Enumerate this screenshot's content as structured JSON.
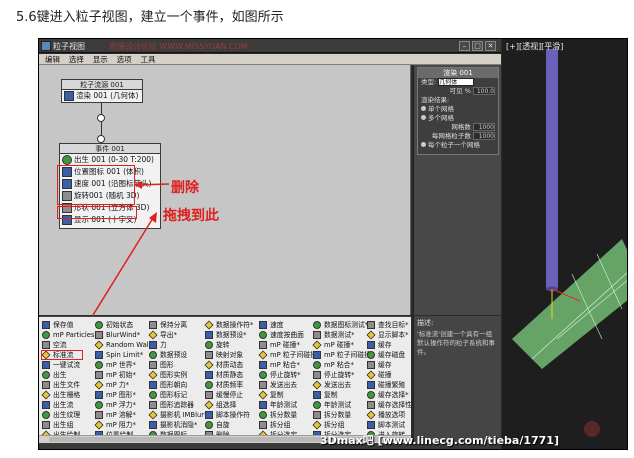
{
  "caption": "5.6键进入粒子视图，建立一个事件，如图所示",
  "window": {
    "title": "粒子视图",
    "watermark": "思缘设计论坛 WWW.MISSYUAN.COM"
  },
  "menu": [
    "编辑",
    "选择",
    "显示",
    "选项",
    "工具"
  ],
  "node_top": {
    "header": "粒子流源 001",
    "rows": [
      "渲染 001 (几何体)"
    ]
  },
  "node_event": {
    "header": "事件 001",
    "rows": [
      "出生 001 (0-30 T:200)",
      "位置图标 001 (体积)",
      "速度 001 (沿图标箭头)",
      "旋转001 (随机 3D)",
      "形状 001 (立方体 3D)",
      "显示 001 (十字叉)"
    ]
  },
  "annotations": {
    "delete": "删除",
    "drag": "拖拽到此"
  },
  "props": {
    "header": "渲染 001",
    "type_label": "类型:",
    "type_value": "几何体",
    "visible_label": "可见 %",
    "visible_value": "100.0",
    "render_label": "渲染结果:",
    "opt1": "单个网格",
    "opt2": "多个网格",
    "mesh_label": "网格数",
    "mesh_value": "1000",
    "per_label": "每网格粒子数",
    "per_value": "1000",
    "opt3": "每个粒子一个网格"
  },
  "depot": [
    [
      "保存值",
      "mP Particles 流",
      "空流",
      "标准流",
      "一键试流",
      "出生",
      "出生文件",
      "出生栅格",
      "出生流",
      "出生纹理",
      "出生组",
      "出生绘制",
      "出生脚本"
    ],
    [
      "初始状态",
      "BlurWind*",
      "Random Walk*",
      "Spin Limit*",
      "mP 世界*",
      "mP 初始*",
      "mP 力*",
      "mP 图形*",
      "mP 浮力*",
      "mP 溶解*",
      "mP 阻力*",
      "位置绘制",
      "位置对象"
    ],
    [
      "保持分离",
      "导出*",
      "力",
      "数据预设",
      "图形",
      "图形实例",
      "图形朝向",
      "图形标记",
      "图形追踪器",
      "摄影机 IMBlur*",
      "摄影机消隐*",
      "数据图标",
      "数据操作符*"
    ],
    [
      "数据操作符*",
      "数据预设*",
      "旋转",
      "映射对象",
      "材质动态",
      "材质静态",
      "材质频率",
      "缓慢停止",
      "组选择",
      "脚本操作符",
      "自旋",
      "删除",
      "数据图标*"
    ],
    [
      "速度",
      "速度按曲面",
      "mP 碰撞*",
      "mP 粒子间碰撞*",
      "mP 粘合*",
      "停止旋转*",
      "发送出去",
      "复制",
      "年龄测试",
      "拆分数量",
      "拆分组",
      "拆分选定",
      "拆分源"
    ],
    [
      "数据图标测试*",
      "数据测试*",
      "mP 碰撞*",
      "mP 粒子间碰撞*",
      "mP 粘合*",
      "停止旋转*",
      "发送出去",
      "复制",
      "年龄测试",
      "拆分数量",
      "拆分组",
      "拆分选定",
      "锁定/粘着"
    ],
    [
      "查找目标*",
      "显示脚本*",
      "缓存",
      "缓存磁盘",
      "缓存",
      "碰撞",
      "碰撞繁殖",
      "缓存选择*",
      "缓存选择性*",
      "播放选项",
      "脚本测试",
      "进入旋转",
      "速度测试"
    ]
  ],
  "desc": {
    "title": "描述:",
    "text": "'标准流'创建一个具有一组默认操作符的粒子系统和事件。"
  },
  "viewport": {
    "label": "[+][透视][平滑]"
  },
  "footer": "3Dmax吧 [www.linecg.com/tieba/1771]",
  "colors": {
    "accent_red": "#e02020",
    "node_blue": "#3a5ea8",
    "viewport_green": "#7fd07f"
  }
}
